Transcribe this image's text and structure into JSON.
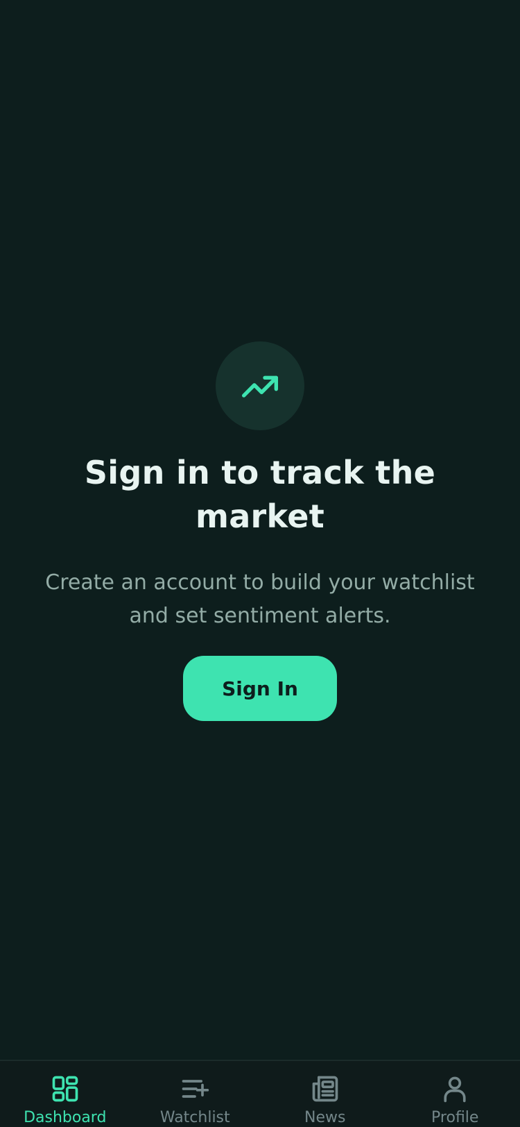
{
  "colors": {
    "background": "#0d1e1d",
    "accent": "#3ee3b0",
    "badge_bg": "#16322d",
    "title": "#e8f4f1",
    "subtitle": "#93aca6",
    "tab_inactive": "#74878a"
  },
  "hero": {
    "icon": "trending-up-icon",
    "title": "Sign in to track the market",
    "subtitle": "Create an account to build your watchlist and set sentiment alerts.",
    "button_label": "Sign In"
  },
  "tab_bar": {
    "active_tab": "Dashboard",
    "tabs": [
      {
        "label": "Dashboard",
        "icon": "dashboard-grid-icon"
      },
      {
        "label": "Watchlist",
        "icon": "list-add-icon"
      },
      {
        "label": "News",
        "icon": "newspaper-icon"
      },
      {
        "label": "Profile",
        "icon": "user-icon"
      }
    ]
  }
}
